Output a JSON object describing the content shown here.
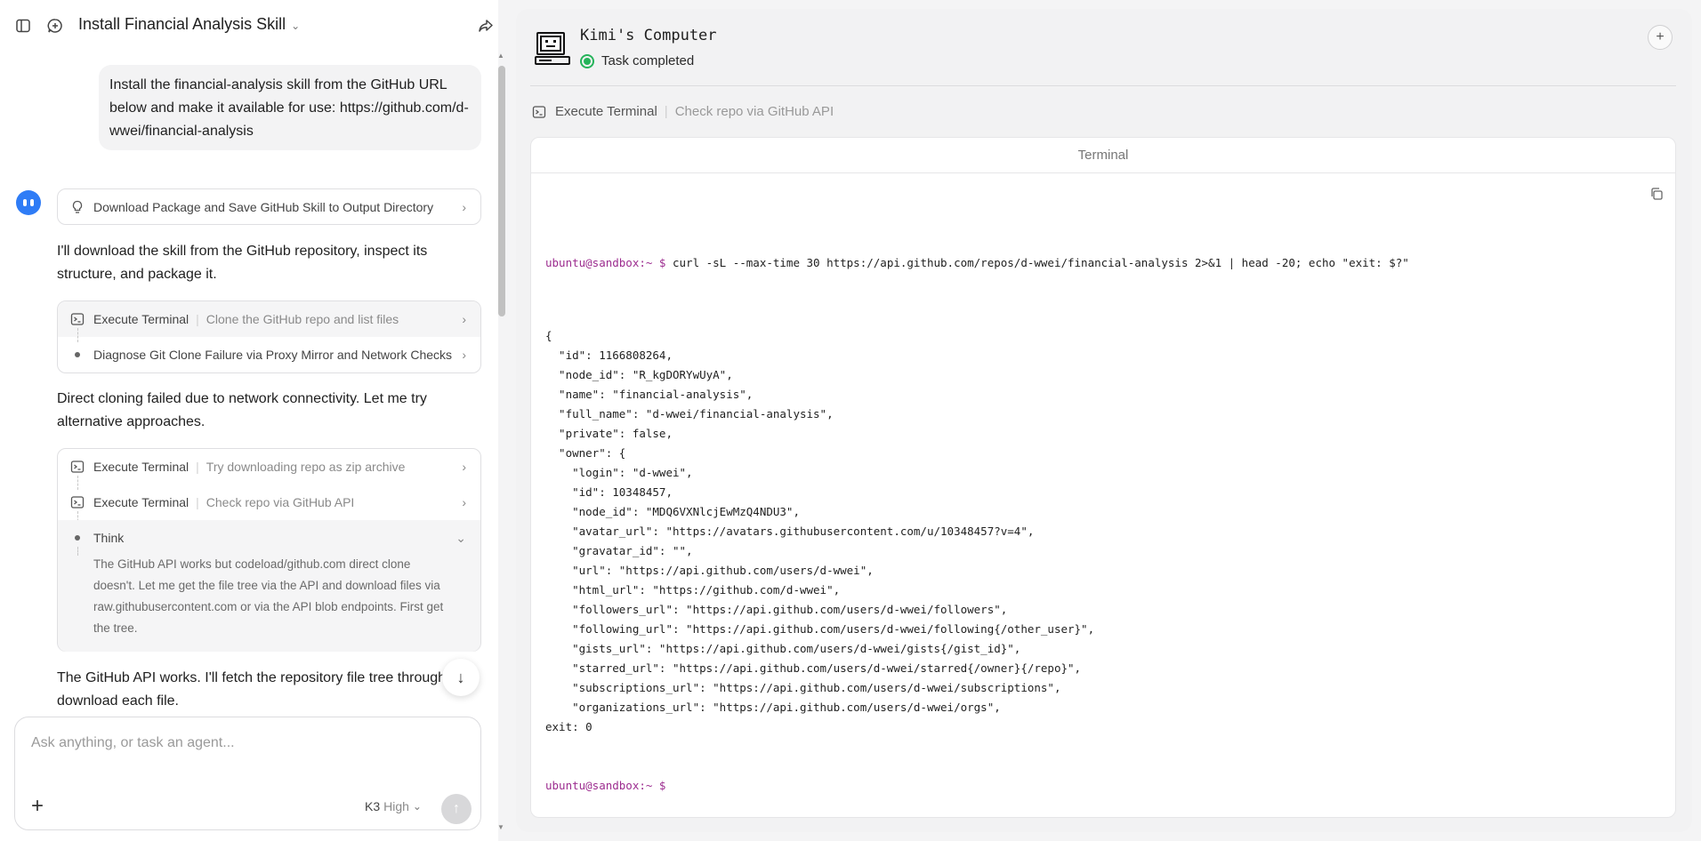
{
  "header": {
    "title": "Install Financial Analysis Skill"
  },
  "chat": {
    "user_message": "Install the financial-analysis skill from the GitHub URL below and make it available for use: https://github.com/d-wwei/financial-analysis",
    "plan_card": "Download Package and Save GitHub Skill to Output Directory",
    "para1": "I'll download the skill from the GitHub repository, inspect its structure, and package it.",
    "step_group1": [
      {
        "label": "Execute Terminal",
        "desc": "Clone the GitHub repo and list files"
      },
      {
        "label": "Diagnose Git Clone Failure via Proxy Mirror and Network Checks",
        "desc": ""
      }
    ],
    "para2": "Direct cloning failed due to network connectivity. Let me try alternative approaches.",
    "step_group2": [
      {
        "label": "Execute Terminal",
        "desc": "Try downloading repo as zip archive"
      },
      {
        "label": "Execute Terminal",
        "desc": "Check repo via GitHub API"
      },
      {
        "label": "Think",
        "desc": ""
      }
    ],
    "think_text": "The GitHub API works but codeload/github.com direct clone doesn't. Let me get the file tree via the API and download files via raw.githubusercontent.com or via the API blob endpoints. First get the tree.",
    "para3": "The GitHub API works. I'll fetch the repository file tree through API and download each file."
  },
  "composer": {
    "placeholder": "Ask anything, or task an agent...",
    "model": "K3",
    "level": "High"
  },
  "computer": {
    "title": "Kimi's Computer",
    "status": "Task completed",
    "action_label": "Execute Terminal",
    "action_desc": "Check repo via GitHub API",
    "terminal_title": "Terminal",
    "prompt": "ubuntu@sandbox:~ $",
    "command": " curl -sL --max-time 30 https://api.github.com/repos/d-wwei/financial-analysis 2>&1 | head -20; echo \"exit: $?\"",
    "output_lines": [
      "{",
      "  \"id\": 1166808264,",
      "  \"node_id\": \"R_kgDORYwUyA\",",
      "  \"name\": \"financial-analysis\",",
      "  \"full_name\": \"d-wwei/financial-analysis\",",
      "  \"private\": false,",
      "  \"owner\": {",
      "    \"login\": \"d-wwei\",",
      "    \"id\": 10348457,",
      "    \"node_id\": \"MDQ6VXNlcjEwMzQ4NDU3\",",
      "    \"avatar_url\": \"https://avatars.githubusercontent.com/u/10348457?v=4\",",
      "    \"gravatar_id\": \"\",",
      "    \"url\": \"https://api.github.com/users/d-wwei\",",
      "    \"html_url\": \"https://github.com/d-wwei\",",
      "    \"followers_url\": \"https://api.github.com/users/d-wwei/followers\",",
      "    \"following_url\": \"https://api.github.com/users/d-wwei/following{/other_user}\",",
      "    \"gists_url\": \"https://api.github.com/users/d-wwei/gists{/gist_id}\",",
      "    \"starred_url\": \"https://api.github.com/users/d-wwei/starred{/owner}{/repo}\",",
      "    \"subscriptions_url\": \"https://api.github.com/users/d-wwei/subscriptions\",",
      "    \"organizations_url\": \"https://api.github.com/users/d-wwei/orgs\",",
      "exit: 0"
    ],
    "final_prompt": "ubuntu@sandbox:~ $"
  },
  "colors": {
    "accent": "#2f7cf6",
    "status_green": "#25b35a",
    "prompt_purple": "#9c2c8f"
  },
  "icons": [
    "sidebar-toggle-icon",
    "new-chat-icon",
    "share-icon",
    "lightbulb-icon",
    "terminal-icon",
    "chevron-right-icon",
    "chevron-down-icon",
    "arrow-down-icon",
    "plus-icon",
    "send-arrow-icon",
    "computer-icon",
    "copy-icon"
  ]
}
